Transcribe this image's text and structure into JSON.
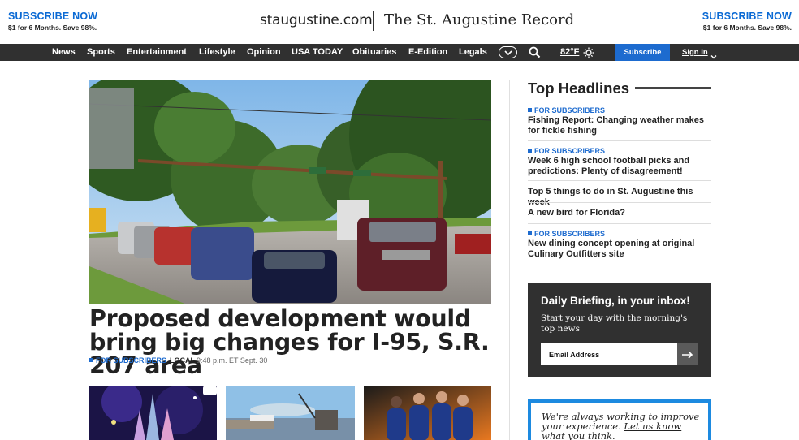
{
  "masthead": {
    "subscribe_left": {
      "title": "SUBSCRIBE NOW",
      "offer": "$1 for 6 Months. Save 98%."
    },
    "subscribe_right": {
      "title": "SUBSCRIBE NOW",
      "offer": "$1 for 6 Months. Save 98%."
    },
    "site": "staugustine.com",
    "paper": "The St. Augustine Record"
  },
  "nav": {
    "items": [
      "News",
      "Sports",
      "Entertainment",
      "Lifestyle",
      "Opinion",
      "USA TODAY",
      "Obituaries",
      "E-Edition",
      "Legals"
    ],
    "weather": "82°F",
    "subscribe": "Subscribe",
    "signin": "Sign In",
    "icons": {
      "more": "more-menu-icon",
      "search": "search-icon",
      "weather": "sun-icon",
      "signin": "chevron-down-icon"
    }
  },
  "hero": {
    "title": "Proposed development would bring big changes for I-95, S.R. 207 area",
    "tag": "FOR SUBSCRIBERS",
    "section": "LOCAL",
    "time": "9:48 p.m. ET Sept. 30"
  },
  "top_headlines": {
    "title": "Top Headlines",
    "items": [
      {
        "tag": "FOR SUBSCRIBERS",
        "headline": "Fishing Report: Changing weather makes for fickle fishing"
      },
      {
        "tag": "FOR SUBSCRIBERS",
        "headline": "Week 6 high school football picks and predictions: Plenty of disagreement!"
      },
      {
        "tag": "",
        "headline": "Top 5 things to do in St. Augustine this week"
      },
      {
        "tag": "",
        "headline": "A new bird for Florida?"
      },
      {
        "tag": "FOR SUBSCRIBERS",
        "headline": "New dining concept opening at original Culinary Outfitters site"
      }
    ]
  },
  "newsletter": {
    "title": "Daily Briefing, in your inbox!",
    "description": "Start your day with the morning's top news",
    "placeholder": "Email Address"
  },
  "feedback": {
    "text": "We're always working to improve your experience.",
    "link": "Let us know what you think."
  },
  "colors": {
    "accent": "#1d6bcf",
    "nav_bg": "#303030",
    "feedback_border": "#1d8ae0"
  }
}
